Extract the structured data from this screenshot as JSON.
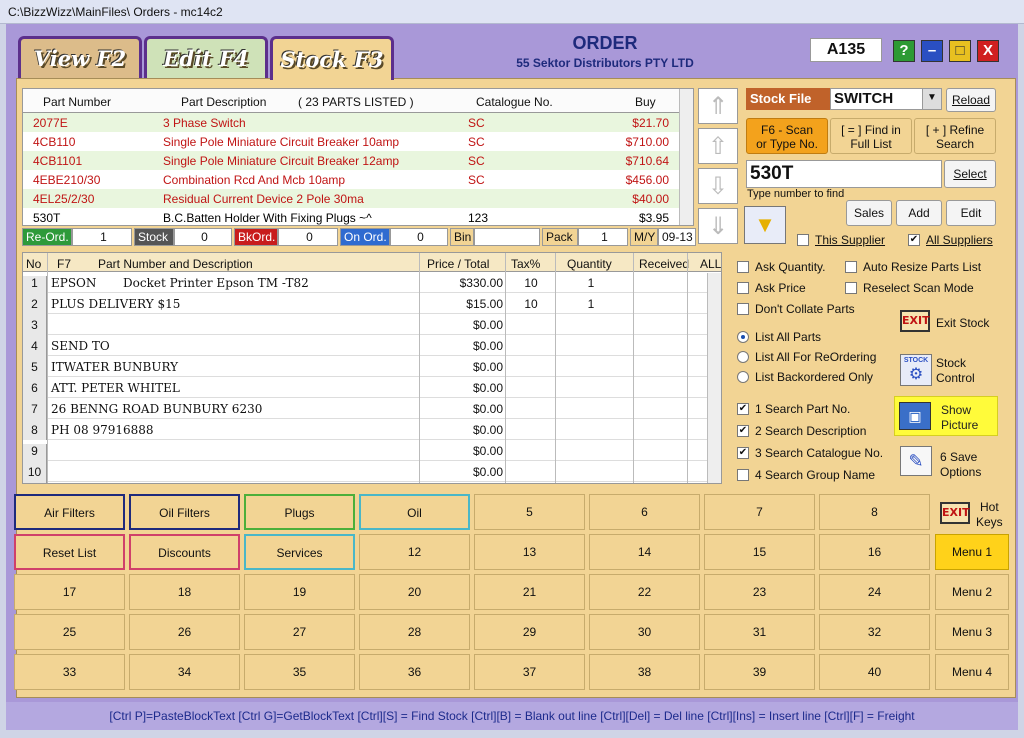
{
  "window_title": "C:\\BizzWizz\\MainFiles\\ Orders - mc14c2",
  "tabs": {
    "view": "View F2",
    "edit": "Edit F4",
    "stock": "Stock F3"
  },
  "header": {
    "title": "ORDER",
    "company": "55 Sektor Distributors PTY LTD",
    "code": "A135"
  },
  "window_buttons": {
    "help": "?",
    "minimize": "–",
    "maximize": "□",
    "close": "X"
  },
  "parts_list": {
    "columns": {
      "part_number": "Part Number",
      "part_description": "Part Description",
      "count": "( 23 PARTS LISTED )",
      "catalogue": "Catalogue No.",
      "buy": "Buy"
    },
    "rows": [
      {
        "part": "2077E",
        "desc": "3 Phase Switch",
        "cat": "SC",
        "buy": "$21.70"
      },
      {
        "part": "4CB110",
        "desc": "Single Pole Miniature Circuit Breaker 10amp",
        "cat": "SC",
        "buy": "$710.00"
      },
      {
        "part": "4CB1101",
        "desc": "Single Pole Miniature Circuit Breaker 12amp",
        "cat": "SC",
        "buy": "$710.64"
      },
      {
        "part": "4EBE210/30",
        "desc": "Combination Rcd And Mcb 10amp",
        "cat": "SC",
        "buy": "$456.00"
      },
      {
        "part": "4EL25/2/30",
        "desc": "Residual Current Device 2 Pole 30ma",
        "cat": "",
        "buy": "$40.00"
      },
      {
        "part": "530T",
        "desc": "B.C.Batten Holder With Fixing Plugs ~^",
        "cat": "123",
        "buy": "$3.95"
      }
    ]
  },
  "infobar": {
    "reord_label": "Re-Ord.",
    "reord_val": "1",
    "stock_label": "Stock",
    "stock_val": "0",
    "bkord_label": "BkOrd.",
    "bkord_val": "0",
    "onord_label": "On Ord.",
    "onord_val": "0",
    "bin_label": "Bin",
    "bin_val": "",
    "pack_label": "Pack",
    "pack_val": "1",
    "my_label": "M/Y",
    "my_val": "09-13"
  },
  "order_grid": {
    "columns": {
      "no": "No",
      "f7": "F7",
      "desc": "Part Number and Description",
      "price": "Price / Total",
      "tax": "Tax%",
      "qty": "Quantity",
      "received": "Received",
      "all": "ALL"
    },
    "rows": [
      {
        "no": "1",
        "part": "EPSON",
        "desc": "Docket Printer Epson TM -T82",
        "price": "$330.00",
        "tax": "10",
        "qty": "1"
      },
      {
        "no": "2",
        "part": "PLUS DELIVERY $15",
        "desc": "",
        "price": "$15.00",
        "tax": "10",
        "qty": "1"
      },
      {
        "no": "3",
        "part": "",
        "desc": "",
        "price": "$0.00",
        "tax": "",
        "qty": ""
      },
      {
        "no": "4",
        "part": "SEND TO",
        "desc": "",
        "price": "$0.00",
        "tax": "",
        "qty": ""
      },
      {
        "no": "5",
        "part": "ITWATER BUNBURY",
        "desc": "",
        "price": "$0.00",
        "tax": "",
        "qty": ""
      },
      {
        "no": "6",
        "part": "ATT. PETER WHITEL",
        "desc": "",
        "price": "$0.00",
        "tax": "",
        "qty": ""
      },
      {
        "no": "7",
        "part": "26 BENNG ROAD BUNBURY 6230",
        "desc": "",
        "price": "$0.00",
        "tax": "",
        "qty": ""
      },
      {
        "no": "8",
        "part": "PH  08 97916888",
        "desc": "",
        "price": "$0.00",
        "tax": "",
        "qty": ""
      },
      {
        "no": "9",
        "part": "",
        "desc": "",
        "price": "$0.00",
        "tax": "",
        "qty": ""
      },
      {
        "no": "10",
        "part": "",
        "desc": "",
        "price": "$0.00",
        "tax": "",
        "qty": ""
      }
    ]
  },
  "stock_panel": {
    "stock_file_label": "Stock File",
    "stock_file_value": "SWITCH",
    "reload": "Reload",
    "scan_line1": "F6 - Scan",
    "scan_line2": "or Type No.",
    "find_line1": "[ = ] Find in",
    "find_line2": "Full List",
    "refine_line1": "[ + ] Refine",
    "refine_line2": "Search",
    "search_value": "530T",
    "select": "Select",
    "type_hint": "Type number to find",
    "sales": "Sales",
    "add": "Add",
    "edit": "Edit",
    "this_supplier": "This Supplier",
    "all_suppliers": "All Suppliers"
  },
  "options": {
    "ask_quantity": "Ask Quantity.",
    "auto_resize": "Auto Resize Parts List",
    "ask_price": "Ask Price",
    "reselect_scan": "Reselect Scan Mode",
    "dont_collate": "Don't Collate Parts",
    "list_all": "List All Parts",
    "list_reorder": "List All For ReOrdering",
    "list_backordered": "List Backordered Only",
    "search_part": "1 Search Part No.",
    "search_desc": "2 Search Description",
    "search_cat": "3 Search Catalogue No.",
    "search_group": "4 Search Group Name",
    "exit_stock": "Exit Stock",
    "stock_control_1": "Stock",
    "stock_control_2": "Control",
    "show_picture_1": "Show",
    "show_picture_2": "Picture",
    "save_options_1": "6 Save",
    "save_options_2": "Options",
    "exit_icon_text": "EXIT",
    "stock_icon_text": "STOCK"
  },
  "hotkeys": {
    "keys": [
      "Air Filters",
      "Oil Filters",
      "Plugs",
      "Oil",
      "5",
      "6",
      "7",
      "8",
      "Reset List",
      "Discounts",
      "Services",
      "12",
      "13",
      "14",
      "15",
      "16",
      "17",
      "18",
      "19",
      "20",
      "21",
      "22",
      "23",
      "24",
      "25",
      "26",
      "27",
      "28",
      "29",
      "30",
      "31",
      "32",
      "33",
      "34",
      "35",
      "36",
      "37",
      "38",
      "39",
      "40"
    ],
    "hot_keys_1": "Hot",
    "hot_keys_2": "Keys",
    "menus": [
      "Menu 1",
      "Menu 2",
      "Menu 3",
      "Menu 4"
    ]
  },
  "status_bar": "[Ctrl P]=PasteBlockText  [Ctrl G]=GetBlockText  [Ctrl][S] = Find Stock  [Ctrl][B] = Blank out line  [Ctrl][Del] = Del line  [Ctrl][Ins] = Insert line  [Ctrl][F] = Freight"
}
